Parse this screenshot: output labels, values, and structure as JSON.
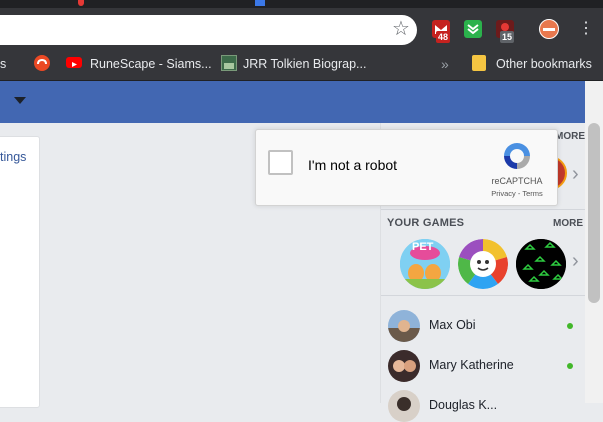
{
  "browser": {
    "bookmarks": [
      {
        "label": "",
        "icon": "stumbleupon-icon",
        "color": "#eb4924"
      },
      {
        "label": "RuneScape - Siams...",
        "icon": "youtube-icon",
        "color": "#ff0000"
      },
      {
        "label": "JRR Tolkien Biograp...",
        "icon": "page-thumbnail-icon",
        "color": "#7a9a7a"
      }
    ],
    "overflow_label": "»",
    "other_bookmarks_label": "Other bookmarks",
    "extensions": [
      {
        "name": "gmail-extension-icon",
        "badge": "48",
        "color": "#c5221f"
      },
      {
        "name": "feedly-extension-icon",
        "badge": "",
        "color": "#2bb24c"
      },
      {
        "name": "unread-extension-icon",
        "badge": "15",
        "color": "#b3261e"
      }
    ],
    "left_edge_text": "s"
  },
  "facebook": {
    "brand_color": "#4267b2",
    "left_panel_link": "tings",
    "games_section": {
      "title": "YOUR GAMES",
      "more_label": "MORE",
      "games": [
        {
          "name": "pet-rescue-game-icon",
          "label": "PET"
        },
        {
          "name": "trivia-crack-game-icon",
          "label": ""
        },
        {
          "name": "space-game-icon",
          "label": ""
        }
      ]
    },
    "top_section_more": "MORE",
    "contacts": [
      {
        "name": "Max Obi",
        "online": true
      },
      {
        "name": "Mary Katherine",
        "online": true
      },
      {
        "name": "Douglas K...",
        "online": false
      }
    ]
  },
  "recaptcha": {
    "checkbox_label": "I'm not a robot",
    "brand": "reCAPTCHA",
    "privacy_label": "Privacy",
    "separator": " - ",
    "terms_label": "Terms"
  }
}
